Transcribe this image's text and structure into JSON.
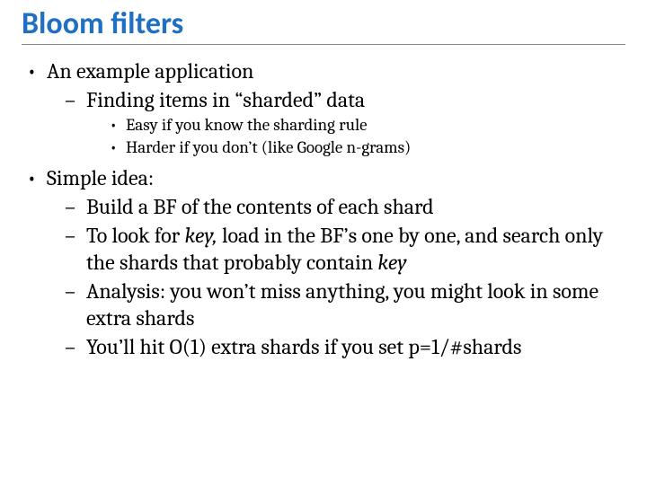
{
  "title": "Bloom filters",
  "bullets": {
    "b1": "An example application",
    "b1_1": "Finding items in “sharded” data",
    "b1_1_1": "Easy if you know the sharding rule",
    "b1_1_2": "Harder if you don’t (like Google n-grams)",
    "b2": "Simple idea:",
    "b2_1": "Build a BF of the contents of each shard",
    "b2_2_pre": "To look for ",
    "b2_2_key1": "key,",
    "b2_2_mid": " load in the BF’s one by one, and search only the shards that probably contain ",
    "b2_2_key2": "key",
    "b2_3": "Analysis: you won’t miss anything, you might look in some extra shards",
    "b2_4": "You’ll hit O(1) extra shards if you set p=1/#shards"
  }
}
